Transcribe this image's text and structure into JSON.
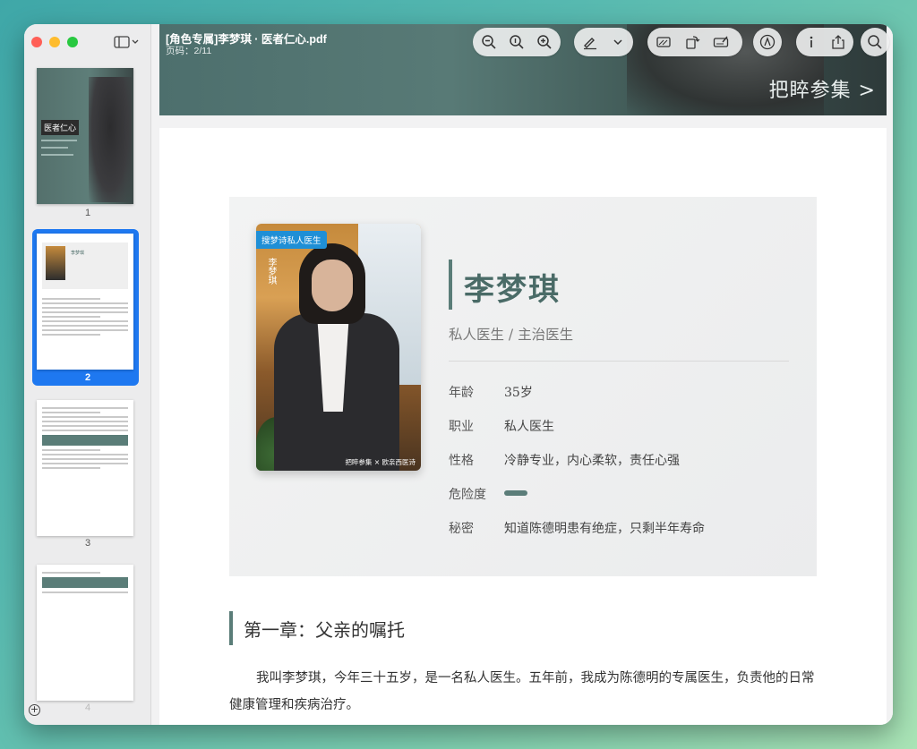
{
  "window": {
    "file_name": "[角色专属]李梦琪 · 医者仁心.pdf",
    "page_indicator": "页码：2/11"
  },
  "sidebar": {
    "pages": [
      {
        "number": "1",
        "title": "医者仁心"
      },
      {
        "number": "2",
        "name": "李梦琪"
      },
      {
        "number": "3"
      },
      {
        "number": "4"
      }
    ],
    "selected_page": "2"
  },
  "toolbar": {
    "icons": [
      "zoom-out-icon",
      "actual-size-icon",
      "zoom-in-icon",
      "highlight-pen-icon",
      "chevron-down-icon",
      "crop-icon",
      "rotate-icon",
      "form-sign-icon",
      "markup-icon",
      "info-icon",
      "share-icon",
      "search-icon"
    ]
  },
  "banner": {
    "link_text": "把睟参集 >"
  },
  "profile": {
    "photo_badge": "搜梦诗私人医生",
    "photo_vertical_text": "李梦琪",
    "photo_footer": "把睟参集 × 欧亲西医诗",
    "name": "李梦琪",
    "role": "私人医生 / 主治医生",
    "attributes": [
      {
        "key": "年龄",
        "value": "35岁"
      },
      {
        "key": "职业",
        "value": "私人医生"
      },
      {
        "key": "性格",
        "value": "冷静专业，内心柔软，责任心强"
      },
      {
        "key": "危险度",
        "value": ""
      },
      {
        "key": "秘密",
        "value": "知道陈德明患有绝症，只剩半年寿命"
      }
    ],
    "risk_level": 0.2
  },
  "chapter": {
    "title": "第一章：父亲的嘱托",
    "paragraph": "我叫李梦琪，今年三十五岁，是一名私人医生。五年前，我成为陈德明的专属医生，负责他的日常健康管理和疾病治疗。"
  },
  "colors": {
    "accent": "#5a7d78",
    "selection": "#1e78f0"
  }
}
